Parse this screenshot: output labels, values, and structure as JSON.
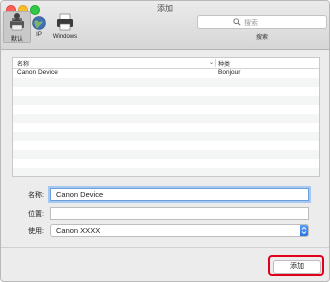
{
  "window": {
    "title": "添加"
  },
  "toolbar": {
    "tabs": [
      {
        "label": "默认",
        "icon": "default-printer-icon"
      },
      {
        "label": "IP",
        "icon": "globe-icon"
      },
      {
        "label": "Windows",
        "icon": "printer-icon"
      }
    ]
  },
  "search": {
    "placeholder": "搜索",
    "caption": "搜索"
  },
  "list": {
    "headers": {
      "name": "名称",
      "kind": "种类"
    },
    "rows": [
      {
        "name": "Canon Device",
        "kind": "Bonjour"
      }
    ]
  },
  "form": {
    "name_label": "名称:",
    "name_value": "Canon Device",
    "location_label": "位置:",
    "location_value": "",
    "use_label": "使用:",
    "use_value": "Canon XXXX"
  },
  "footer": {
    "add_label": "添加"
  },
  "colors": {
    "highlight": "#e0001b",
    "accent": "#2a74e0"
  }
}
